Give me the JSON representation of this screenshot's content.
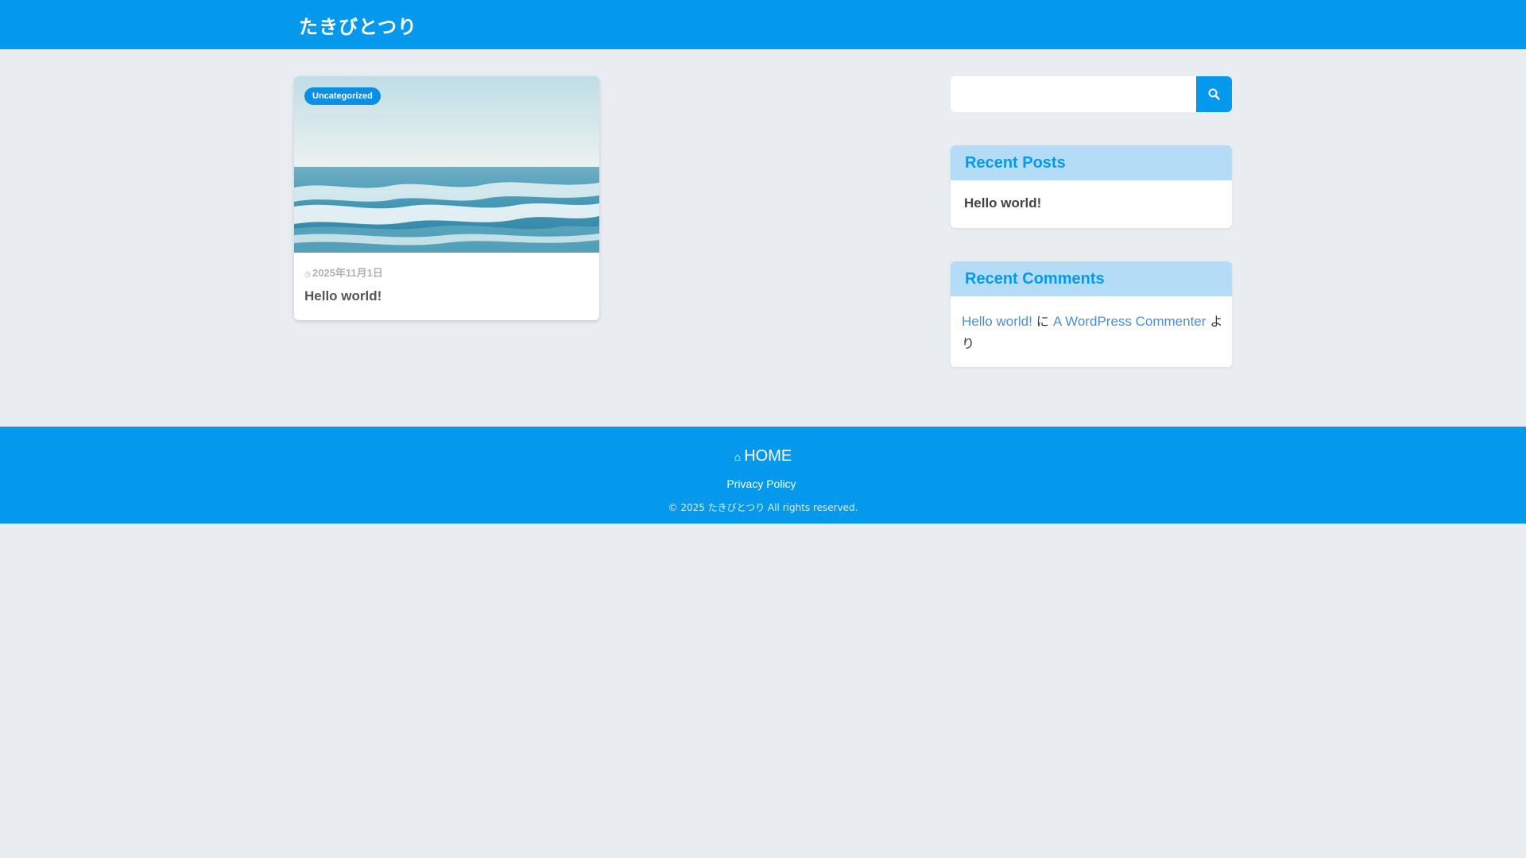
{
  "site": {
    "title": "たきびとつり",
    "accent_color": "#0599ee"
  },
  "main": {
    "posts": [
      {
        "category": "Uncategorized",
        "date": "2025年11月1日",
        "title": "Hello world!",
        "thumbnail_icon": "ocean-waves-image",
        "date_icon": "clock-icon"
      }
    ]
  },
  "sidebar": {
    "search": {
      "placeholder": "",
      "button_icon": "search-icon"
    },
    "recent_posts": {
      "heading": "Recent Posts",
      "items": [
        "Hello world!"
      ]
    },
    "recent_comments": {
      "heading": "Recent Comments",
      "items": [
        {
          "post": "Hello world!",
          "connector": "に",
          "author": "A WordPress Commenter",
          "suffix": "より"
        }
      ]
    }
  },
  "footer": {
    "home_label": "HOME",
    "home_icon": "home-icon",
    "privacy_label": "Privacy Policy",
    "copyright": "© 2025 たきびとつり All rights reserved."
  }
}
